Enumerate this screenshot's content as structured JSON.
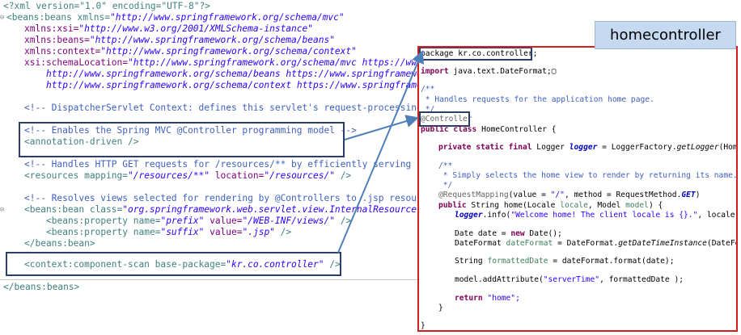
{
  "badge": {
    "title": "homecontroller"
  },
  "xml": {
    "l1": "<?xml version=\"1.0\" encoding=\"UTF-8\"?>",
    "l2a": "<beans:beans xmlns=",
    "l2b": "\"http://www.springframework.org/schema/mvc\"",
    "l3a": "xmlns:xsi=",
    "l3b": "\"http://www.w3.org/2001/XMLSchema-instance\"",
    "l4a": "xmlns:beans=",
    "l4b": "\"http://www.springframework.org/schema/beans\"",
    "l5a": "xmlns:context=",
    "l5b": "\"http://www.springframework.org/schema/context\"",
    "l6a": "xsi:schemaLocation=",
    "l6b": "\"http://www.springframework.org/schema/mvc https://www.spr",
    "l7": "http://www.springframework.org/schema/beans https://www.springframework.o",
    "l8": "http://www.springframework.org/schema/context https://www.springframework.",
    "l9": "<!-- DispatcherServlet Context: defines this servlet's request-processing infr",
    "l10": "<!-- Enables the Spring MVC @Controller programming model -->",
    "l11": "<annotation-driven />",
    "l12": "<!-- Handles HTTP GET requests for /resources/** by efficiently serving up sta",
    "l13a": "<resources mapping=",
    "l13b": "\"/resources/**\"",
    "l13c": " location=",
    "l13d": "\"/resources/\"",
    "l13e": " />",
    "l14": "<!-- Resolves views selected for rendering by @Controllers to .jsp resources i",
    "l15a": "<beans:bean class=",
    "l15b": "\"org.springframework.web.servlet.view.InternalResourceViewRe",
    "l16a": "<beans:property name=",
    "l16b": "\"prefix\"",
    "l16c": " value=",
    "l16d": "\"/WEB-INF/views/\"",
    "l16e": " />",
    "l17a": "<beans:property name=",
    "l17b": "\"suffix\"",
    "l17c": " value=",
    "l17d": "\".jsp\"",
    "l17e": " />",
    "l18": "</beans:bean>",
    "l19a": "<context:component-scan base-package=",
    "l19b": "\"kr.co.controller\"",
    "l19c": " />",
    "l20": "</beans:beans>"
  },
  "java": {
    "j1": "package kr.co.controller;",
    "j2a": "import",
    "j2b": " java.text.DateFormat;",
    "j3": "/**",
    "j4": " * Handles requests for the application home page.",
    "j5": " */",
    "j6": "@Controller",
    "j7a": "public class",
    "j7b": " HomeController {",
    "j8a": "private static final",
    "j8b": " Logger ",
    "j8c": "logger",
    "j8d": " = LoggerFactory.",
    "j8e": "getLogger",
    "j8f": "(HomeContr",
    "j9": "/**",
    "j10": " * Simply selects the home view to render by returning its name.",
    "j11": " */",
    "j12a": "@RequestMapping",
    "j12b": "(value = ",
    "j12c": "\"/\"",
    "j12d": ", method = RequestMethod.",
    "j12e": "GET",
    "j12f": ")",
    "j13a": "public",
    "j13b": " String home(Locale ",
    "j13c": "locale",
    "j13d": ", Model ",
    "j13e": "model",
    "j13f": ") {",
    "j14a": "logger",
    "j14b": ".info(",
    "j14c": "\"Welcome home! The client locale is {}.\"",
    "j14d": ", locale);",
    "j15a": "Date date = ",
    "j15b": "new",
    "j15c": " Date();",
    "j16a": "DateFormat ",
    "j16b": "dateFormat",
    "j16c": " = DateFormat.",
    "j16d": "getDateTimeInstance",
    "j16e": "(DateFormat",
    "j17a": "String ",
    "j17b": "formattedDate",
    "j17c": " = dateFormat.format(date);",
    "j18a": "model.addAttribute(",
    "j18b": "\"serverTime\"",
    "j18c": ", formattedDate );",
    "j19a": "return",
    "j19b": " \"home\";",
    "j20": "}",
    "j21": "}"
  },
  "colors": {
    "highlight": "#2d3d6b",
    "panel_border": "#d21f1f",
    "badge_bg": "#c5d9f1",
    "arrow": "#4f7fb8"
  }
}
